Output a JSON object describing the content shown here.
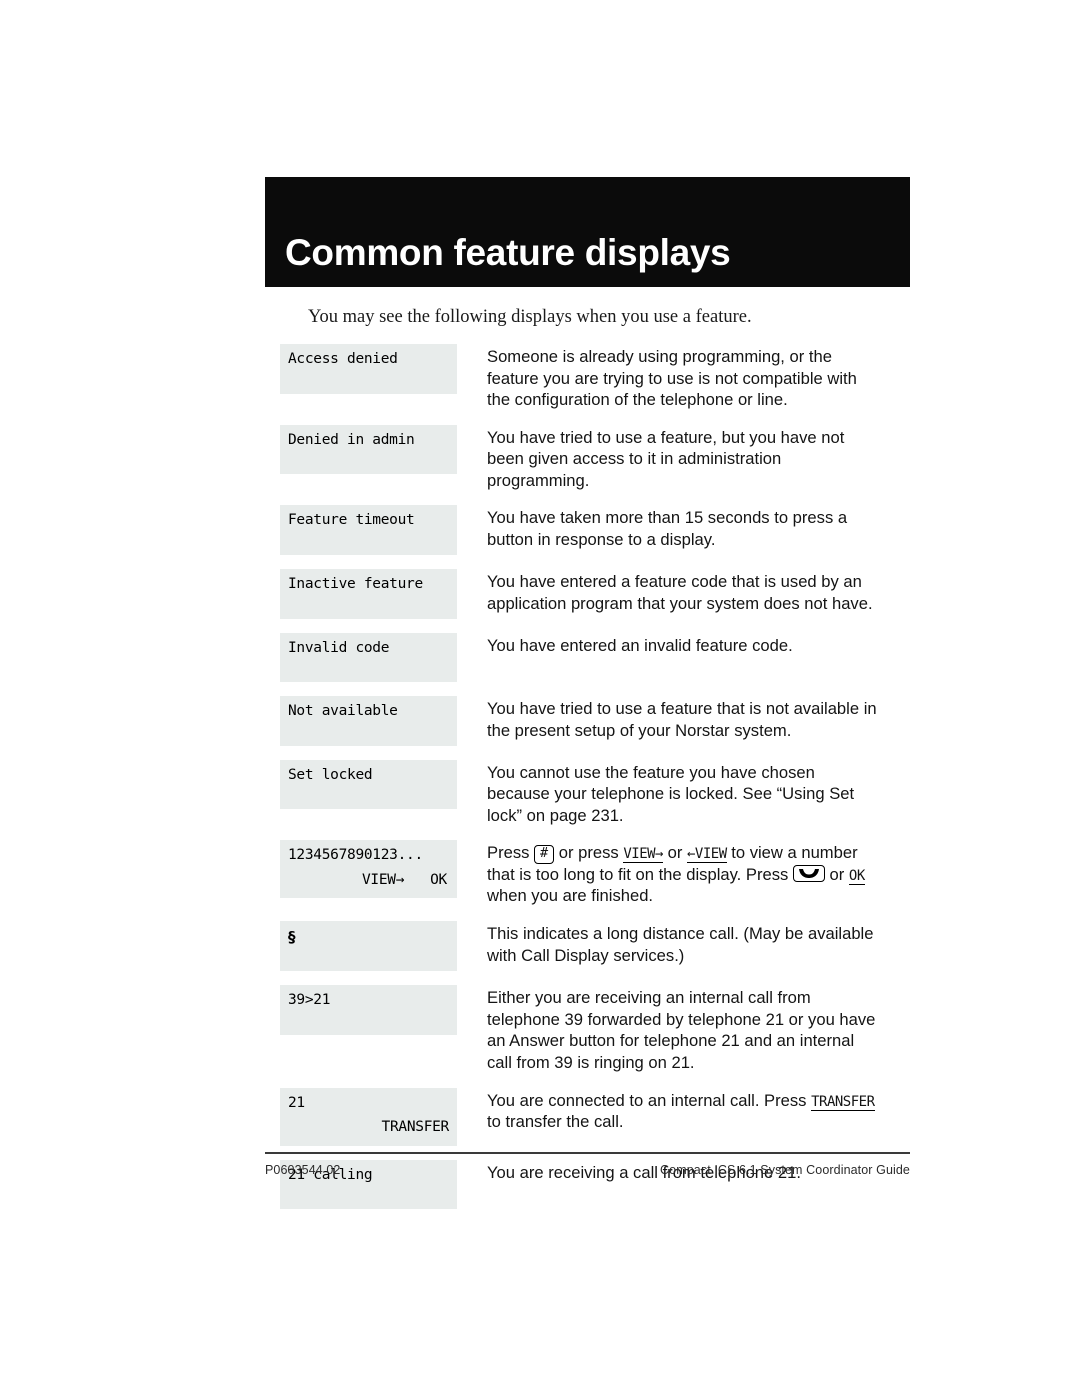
{
  "header": {
    "title": "Common feature displays"
  },
  "intro": "You may see the following displays when you use a feature.",
  "rows": [
    {
      "display_line1": "Access denied",
      "display_line2": "",
      "description": "Someone is already using programming, or the feature you are trying to use is not compatible with the configuration of the telephone or line."
    },
    {
      "display_line1": "Denied in admin",
      "display_line2": "",
      "description": "You have tried to use a feature, but you have not been given access to it in administration programming."
    },
    {
      "display_line1": "Feature timeout",
      "display_line2": "",
      "description": "You have taken more than 15 seconds to press a button in response to a display."
    },
    {
      "display_line1": "Inactive feature",
      "display_line2": "",
      "description": "You have entered a feature code that is used by an application program that your system does not have."
    },
    {
      "display_line1": "Invalid code",
      "display_line2": "",
      "description": "You have entered an invalid feature code."
    },
    {
      "display_line1": "Not available",
      "display_line2": "",
      "description": "You have tried to use a feature that is not available in the present setup of your Norstar system."
    },
    {
      "display_line1": "Set locked",
      "display_line2": "",
      "description": "You cannot use the feature you have chosen because your telephone is locked. See “Using Set lock” on page 231."
    },
    {
      "display_line1": "1234567890123...",
      "softkey_left": "VIEW→",
      "softkey_right": "OK",
      "description_parts": {
        "t1": "Press ",
        "key1": "#",
        "t2": " or press ",
        "sk1": "VIEW→",
        "t3": " or ",
        "sk2": "←VIEW",
        "t4": " to view a number that is too long to fit on the display. Press ",
        "key2": "release-key",
        "t5": " or ",
        "sk3": "OK",
        "t6": " when you are finished."
      }
    },
    {
      "display_line1": "§",
      "display_line2": "",
      "description": "This indicates a long distance call. (May be available with Call Display services.)"
    },
    {
      "display_line1": "39>21",
      "display_line2": "",
      "description": "Either you are receiving an internal call from telephone 39 forwarded by telephone 21 or you have an Answer button for telephone 21 and an internal call from 39 is ringing on 21."
    },
    {
      "display_line1": "21",
      "softkey_right": "TRANSFER",
      "description_parts": {
        "t1": "You are connected to an internal call. Press ",
        "sk1": "TRANSFER",
        "t2": " to transfer the call."
      }
    },
    {
      "display_line1": "21 calling",
      "display_line2": "",
      "description": "You are receiving a call from telephone 21."
    }
  ],
  "footer": {
    "left": "P0603544   02",
    "right": "Compact ICS 6.1 System Coordinator Guide"
  },
  "colors": {
    "header_bar": "#0b0b0b",
    "lcd_background": "#e8eceb",
    "text": "#000000"
  }
}
